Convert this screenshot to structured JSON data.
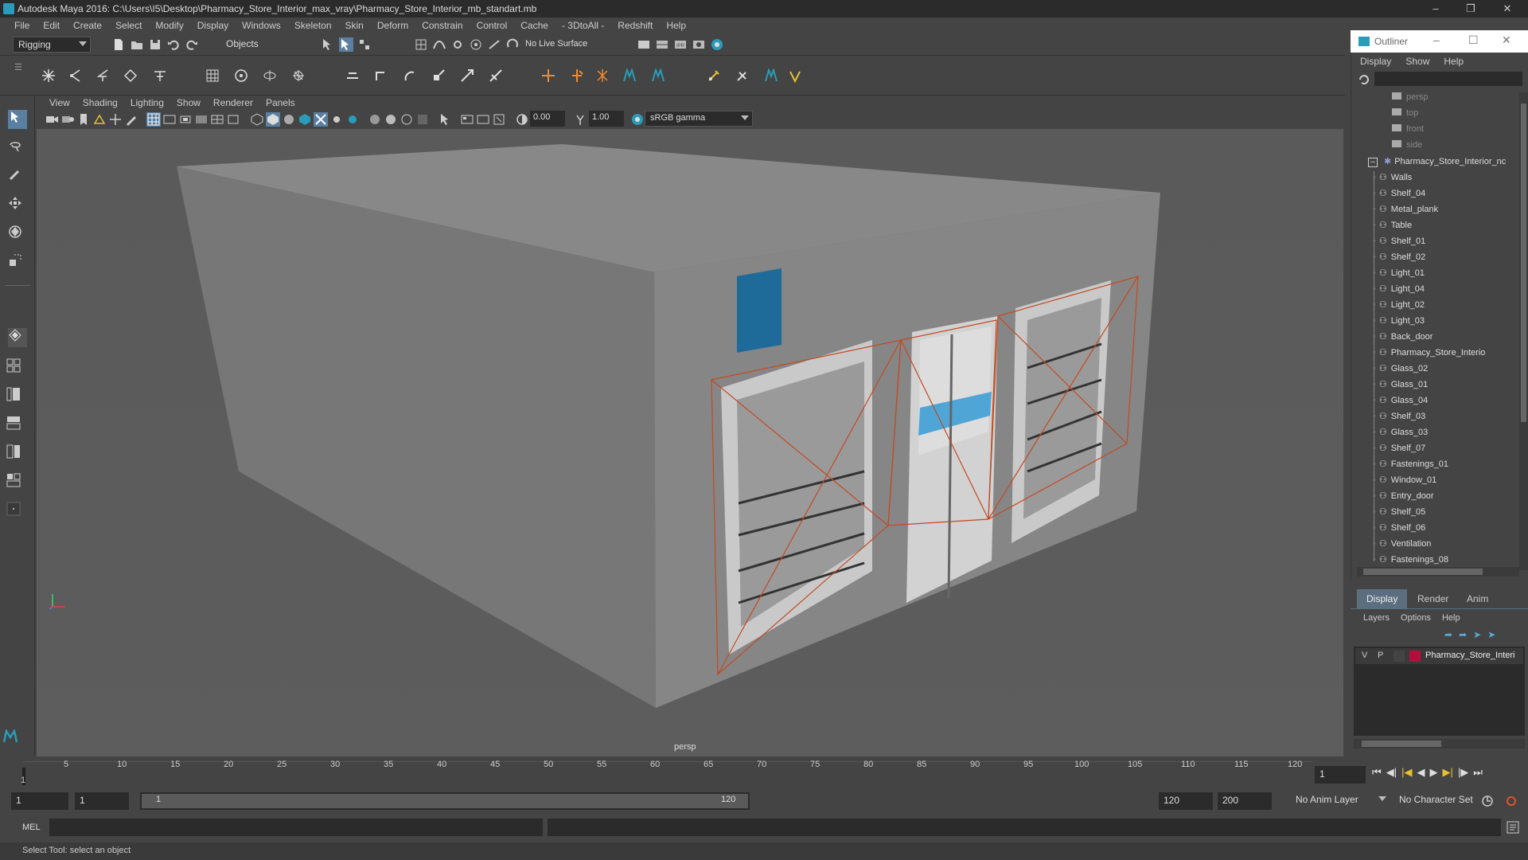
{
  "window": {
    "title": "Autodesk Maya 2016: C:\\Users\\I5\\Desktop\\Pharmacy_Store_Interior_max_vray\\Pharmacy_Store_Interior_mb_standart.mb"
  },
  "menubar": [
    "File",
    "Edit",
    "Create",
    "Select",
    "Modify",
    "Display",
    "Windows",
    "Skeleton",
    "Skin",
    "Deform",
    "Constrain",
    "Control",
    "Cache",
    "- 3DtoAll -",
    "Redshift",
    "Help"
  ],
  "statusline": {
    "menuset": "Rigging",
    "selection_mode": "Objects",
    "live_surface": "No Live Surface"
  },
  "panel_menu": [
    "View",
    "Shading",
    "Lighting",
    "Show",
    "Renderer",
    "Panels"
  ],
  "panel_toolbar": {
    "exposure": "0.00",
    "gamma": "1.00",
    "color_space": "sRGB gamma"
  },
  "viewport": {
    "camera_label": "persp"
  },
  "timeslider": {
    "ticks": [
      "1",
      "5",
      "10",
      "15",
      "20",
      "25",
      "30",
      "35",
      "40",
      "45",
      "50",
      "55",
      "60",
      "65",
      "70",
      "75",
      "80",
      "85",
      "90",
      "95",
      "100",
      "105",
      "110",
      "115",
      "120"
    ],
    "current_frame": "1"
  },
  "rangeslider": {
    "start": "1",
    "current": "1",
    "range_start": "1",
    "range_end": "120",
    "end": "120",
    "anim_end": "200",
    "anim_layer": "No Anim Layer",
    "character_set": "No Character Set"
  },
  "cmdline": {
    "label": "MEL"
  },
  "helpline": {
    "text": "Select Tool: select an object"
  },
  "outliner": {
    "title": "Outliner",
    "menu": [
      "Display",
      "Show",
      "Help"
    ],
    "cameras": [
      "persp",
      "top",
      "front",
      "side"
    ],
    "root": "Pharmacy_Store_Interior_nc",
    "children": [
      "Walls",
      "Shelf_04",
      "Metal_plank",
      "Table",
      "Shelf_01",
      "Shelf_02",
      "Light_01",
      "Light_04",
      "Light_02",
      "Light_03",
      "Back_door",
      "Pharmacy_Store_Interio",
      "Glass_02",
      "Glass_01",
      "Glass_04",
      "Shelf_03",
      "Glass_03",
      "Shelf_07",
      "Fastenings_01",
      "Window_01",
      "Entry_door",
      "Shelf_05",
      "Shelf_06",
      "Ventilation",
      "Fastenings_08"
    ]
  },
  "layers": {
    "tabs": [
      "Display",
      "Render",
      "Anim"
    ],
    "menu": [
      "Layers",
      "Options",
      "Help"
    ],
    "layer": {
      "v": "V",
      "p": "P",
      "name": "Pharmacy_Store_Interi",
      "color": "#b0103a"
    }
  },
  "colors": {
    "accent": "#2a9bb8",
    "selection": "#c24a22"
  }
}
